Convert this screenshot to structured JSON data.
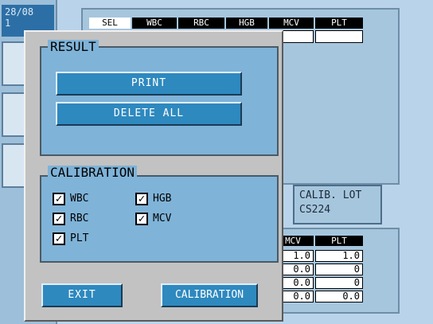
{
  "background": {
    "date_lines": [
      "28/08",
      "1"
    ],
    "top_table_headers": [
      "SEL",
      "WBC",
      "RBC",
      "HGB",
      "MCV",
      "PLT"
    ],
    "calib_lot": {
      "label": "CALIB. LOT",
      "value": "CS224"
    },
    "bottom_table": {
      "headers": [
        "MCV",
        "PLT"
      ],
      "rows": [
        [
          "1.0",
          "1.0"
        ],
        [
          "0.0",
          "0"
        ],
        [
          "0.0",
          "0"
        ],
        [
          "0.0",
          "0.0"
        ]
      ]
    }
  },
  "dialog": {
    "result": {
      "legend": "RESULT",
      "print_label": "PRINT",
      "delete_all_label": "DELETE ALL"
    },
    "calibration_group": {
      "legend": "CALIBRATION",
      "items": [
        {
          "label": "WBC",
          "checked": true
        },
        {
          "label": "HGB",
          "checked": true
        },
        {
          "label": "RBC",
          "checked": true
        },
        {
          "label": "MCV",
          "checked": true
        },
        {
          "label": "PLT",
          "checked": true
        }
      ]
    },
    "exit_label": "EXIT",
    "calibration_label": "CALIBRATION"
  },
  "colors": {
    "dialog_bg": "#c2c2c2",
    "group_bg": "#7fb3d8",
    "button_bg": "#2e89bf",
    "app_bg": "#b9d4ea"
  }
}
